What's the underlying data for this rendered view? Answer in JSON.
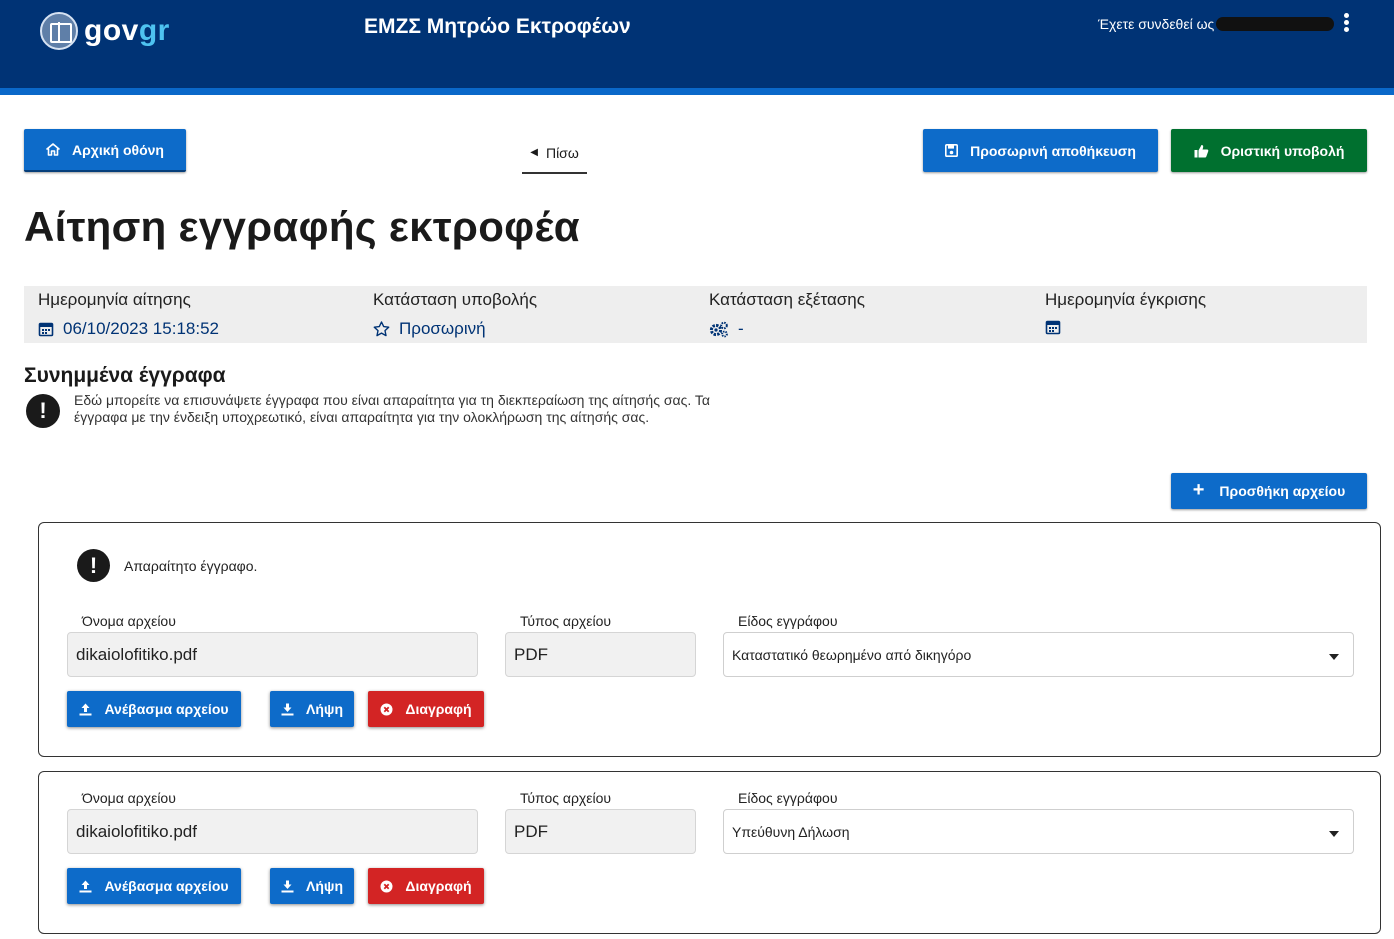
{
  "header": {
    "logo_gov": "gov",
    "logo_gr": "gr",
    "app_title": "ΕΜΖΣ Μητρώο Εκτροφέων",
    "user_label": "Έχετε συνδεθεί ως"
  },
  "toolbar": {
    "home_label": "Αρχική οθόνη",
    "back_label": "Πίσω",
    "save_label": "Προσωρινή αποθήκευση",
    "submit_label": "Οριστική υποβολή"
  },
  "page_title": "Αίτηση εγγραφής εκτροφέα",
  "info": {
    "application_date_label": "Ημερομηνία αίτησης",
    "application_date_value": "06/10/2023 15:18:52",
    "submission_status_label": "Κατάσταση υποβολής",
    "submission_status_value": "Προσωρινή",
    "review_status_label": "Κατάσταση εξέτασης",
    "review_status_value": "-",
    "approval_date_label": "Ημερομηνία έγκρισης",
    "approval_date_value": ""
  },
  "attachments": {
    "title": "Συνημμένα έγγραφα",
    "note": "Εδώ μπορείτε να επισυνάψετε έγγραφα που είναι απαραίτητα για τη διεκπεραίωση της αίτησής σας. Τα έγγραφα με την ένδειξη υποχρεωτικό, είναι απαραίτητα για την ολοκλήρωση της αίτησής σας.",
    "add_button_label": "Προσθήκη αρχείου",
    "documents": [
      {
        "required_text": "Απαραίτητο έγγραφο.",
        "file_name_label": "Όνομα αρχείου",
        "file_name": "dikaiolofitiko.pdf",
        "file_type_label": "Τύπος αρχείου",
        "file_type": "PDF",
        "doc_kind_label": "Είδος εγγράφου",
        "doc_kind": "Καταστατικό θεωρημένο από δικηγόρο",
        "upload_label": "Ανέβασμα αρχείου",
        "download_label": "Λήψη",
        "delete_label": "Διαγραφή"
      },
      {
        "file_name_label": "Όνομα αρχείου",
        "file_name": "dikaiolofitiko.pdf",
        "file_type_label": "Τύπος αρχείου",
        "file_type": "PDF",
        "doc_kind_label": "Είδος εγγράφου",
        "doc_kind": "Υπεύθυνη Δήλωση",
        "upload_label": "Ανέβασμα αρχείου",
        "download_label": "Λήψη",
        "delete_label": "Διαγραφή"
      }
    ]
  },
  "icons": {
    "logo": "greek-emblem-icon",
    "menu": "kebab-menu-icon",
    "home": "home-icon",
    "back": "chevron-left-icon",
    "save": "floppy-disk-icon",
    "submit": "thumbs-up-icon",
    "calendar": "calendar-icon",
    "star": "star-outline-icon",
    "gears": "gears-icon",
    "alert": "exclamation-circle-icon",
    "add": "plus-icon",
    "upload": "upload-icon",
    "download": "download-icon",
    "delete": "close-circle-icon",
    "dropdown": "caret-down-icon"
  },
  "colors": {
    "header_bg": "#003375",
    "header_stripe": "#0a68c9",
    "primary_button": "#0d6bc9",
    "submit_button": "#00702f",
    "delete_button": "#d32424",
    "info_panel_bg": "#eeeeee",
    "info_value_text": "#003375"
  }
}
